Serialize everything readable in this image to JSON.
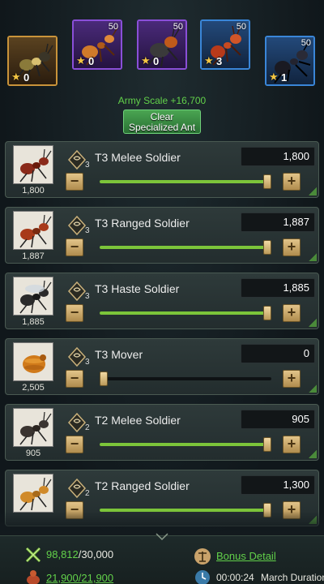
{
  "specialized": [
    {
      "level": "",
      "count": "0",
      "style": "gold"
    },
    {
      "level": "50",
      "count": "0",
      "style": "purple"
    },
    {
      "level": "50",
      "count": "0",
      "style": "purple"
    },
    {
      "level": "50",
      "count": "3",
      "style": "blue"
    },
    {
      "level": "50",
      "count": "1",
      "style": "blue"
    }
  ],
  "army_scale": "Army Scale +16,700",
  "clear_button": {
    "line1": "Clear",
    "line2": "Specialized Ant"
  },
  "rows": [
    {
      "name": "T3 Melee Soldier",
      "tier": "3",
      "available": "1,800",
      "value": "1,800",
      "fill_fraction": 1.0
    },
    {
      "name": "T3 Ranged Soldier",
      "tier": "3",
      "available": "1,887",
      "value": "1,887",
      "fill_fraction": 1.0
    },
    {
      "name": "T3 Haste Soldier",
      "tier": "3",
      "available": "1,885",
      "value": "1,885",
      "fill_fraction": 1.0
    },
    {
      "name": "T3 Mover",
      "tier": "3",
      "available": "2,505",
      "value": "0",
      "fill_fraction": 0.0
    },
    {
      "name": "T2 Melee Soldier",
      "tier": "2",
      "available": "905",
      "value": "905",
      "fill_fraction": 1.0
    },
    {
      "name": "T2 Ranged Soldier",
      "tier": "2",
      "available": "",
      "value": "1,300",
      "fill_fraction": 1.0
    }
  ],
  "bottom": {
    "power_current": "98,812",
    "power_max": "/30,000",
    "troops": "21,900/21,900",
    "bonus_detail": "Bonus Detail",
    "march_time": "00:00:24",
    "march_label": "March Duration"
  },
  "colors": {
    "accent_green": "#62d14a",
    "button_gold": "#d8b877",
    "slider_fill": "#7cc53a"
  }
}
